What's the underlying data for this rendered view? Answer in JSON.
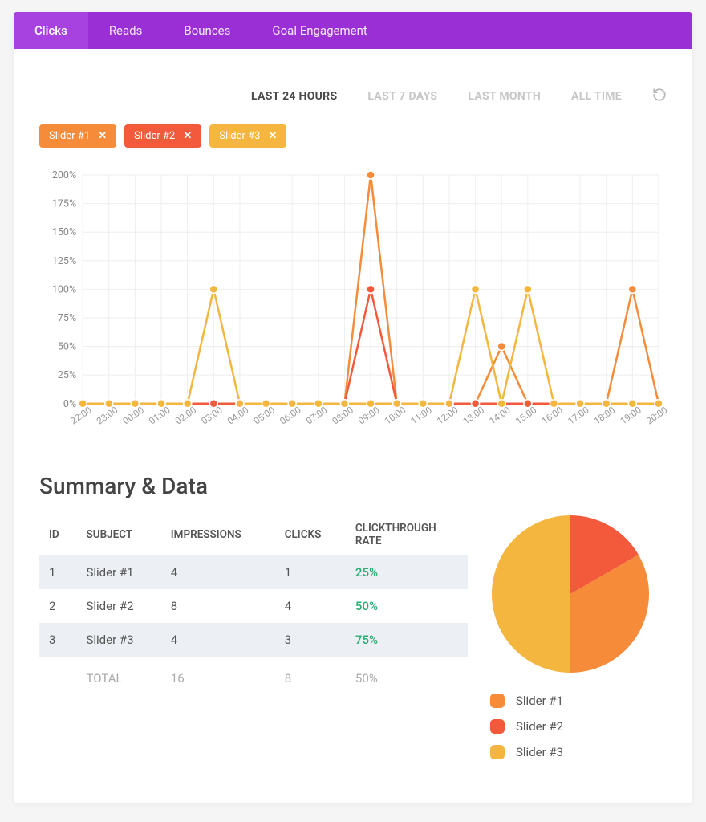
{
  "tabs": [
    {
      "label": "Clicks",
      "active": true
    },
    {
      "label": "Reads",
      "active": false
    },
    {
      "label": "Bounces",
      "active": false
    },
    {
      "label": "Goal Engagement",
      "active": false
    }
  ],
  "timeranges": [
    {
      "label": "LAST 24 HOURS",
      "active": true
    },
    {
      "label": "LAST 7 DAYS",
      "active": false
    },
    {
      "label": "LAST MONTH",
      "active": false
    },
    {
      "label": "ALL TIME",
      "active": false
    }
  ],
  "chips": [
    {
      "label": "Slider #1",
      "color": "#f68b3a"
    },
    {
      "label": "Slider #2",
      "color": "#f3593b"
    },
    {
      "label": "Slider #3",
      "color": "#f4b63f"
    }
  ],
  "chart_data": {
    "type": "line",
    "title": "",
    "xlabel": "",
    "ylabel": "",
    "ylim": [
      0,
      200
    ],
    "yticks": [
      "0%",
      "25%",
      "50%",
      "75%",
      "100%",
      "125%",
      "150%",
      "175%",
      "200%"
    ],
    "categories": [
      "22:00",
      "23:00",
      "00:00",
      "01:00",
      "02:00",
      "03:00",
      "04:00",
      "05:00",
      "06:00",
      "07:00",
      "08:00",
      "09:00",
      "10:00",
      "11:00",
      "12:00",
      "13:00",
      "14:00",
      "15:00",
      "16:00",
      "17:00",
      "18:00",
      "19:00",
      "20:00"
    ],
    "series": [
      {
        "name": "Slider #1",
        "color": "#f68b3a",
        "values": [
          0,
          0,
          0,
          0,
          0,
          0,
          0,
          0,
          0,
          0,
          0,
          200,
          0,
          0,
          0,
          0,
          50,
          0,
          0,
          0,
          0,
          100,
          0
        ]
      },
      {
        "name": "Slider #2",
        "color": "#f3593b",
        "values": [
          0,
          0,
          0,
          0,
          0,
          0,
          0,
          0,
          0,
          0,
          0,
          100,
          0,
          0,
          0,
          0,
          0,
          0,
          0,
          0,
          0,
          0,
          0
        ]
      },
      {
        "name": "Slider #3",
        "color": "#f4b63f",
        "values": [
          0,
          0,
          0,
          0,
          0,
          100,
          0,
          0,
          0,
          0,
          0,
          0,
          0,
          0,
          0,
          100,
          0,
          100,
          0,
          0,
          0,
          0,
          0
        ]
      }
    ]
  },
  "summary_title": "Summary & Data",
  "table": {
    "headers": [
      "ID",
      "SUBJECT",
      "IMPRESSIONS",
      "CLICKS",
      "CLICKTHROUGH RATE"
    ],
    "rows": [
      {
        "id": "1",
        "subject": "Slider #1",
        "impressions": "4",
        "clicks": "1",
        "ctr": "25%"
      },
      {
        "id": "2",
        "subject": "Slider #2",
        "impressions": "8",
        "clicks": "4",
        "ctr": "50%"
      },
      {
        "id": "3",
        "subject": "Slider #3",
        "impressions": "4",
        "clicks": "3",
        "ctr": "75%"
      }
    ],
    "total": {
      "label": "TOTAL",
      "impressions": "16",
      "clicks": "8",
      "ctr": "50%"
    }
  },
  "pie": {
    "slices": [
      {
        "label": "Slider #1",
        "color": "#f68b3a",
        "value": 33.33
      },
      {
        "label": "Slider #2",
        "color": "#f3593b",
        "value": 16.67
      },
      {
        "label": "Slider #3",
        "color": "#f4b63f",
        "value": 50.0
      }
    ],
    "legend": [
      {
        "label": "Slider #1",
        "color": "#f68b3a"
      },
      {
        "label": "Slider #2",
        "color": "#f3593b"
      },
      {
        "label": "Slider #3",
        "color": "#f4b63f"
      }
    ]
  }
}
